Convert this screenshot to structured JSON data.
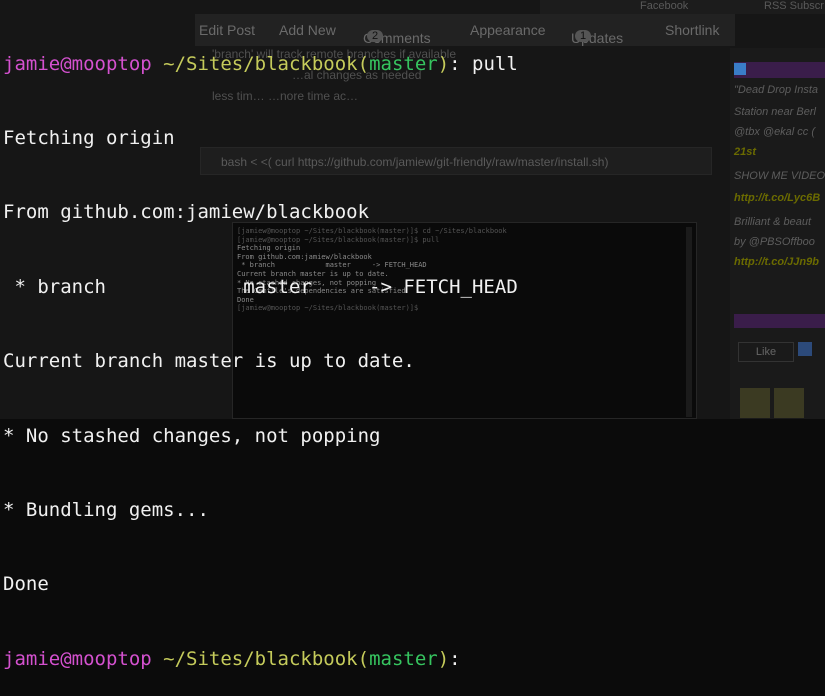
{
  "background_page": {
    "top_tabs": [
      "Facebook",
      "RSS Subscr"
    ],
    "nav_items": [
      {
        "label": "Edit Post"
      },
      {
        "label": "Add New"
      },
      {
        "label": "Comments",
        "badge": "2"
      },
      {
        "label": "Appearance"
      },
      {
        "label": "Updates",
        "badge": "1"
      },
      {
        "label": "Shortlink"
      }
    ],
    "list_lines": [
      "'branch' will track remote branches if available",
      "…al changes as needed",
      "less tim…        …nore time ac…"
    ],
    "code_line": "bash < <( curl https://github.com/jamiew/git-friendly/raw/master/install.sh)",
    "sidebar": {
      "tweets": [
        "\"Dead Drop Insta",
        "Station near Berl",
        "@tbx @ekal cc (",
        "21st",
        "SHOW ME VIDEO",
        "http://t.co/Lyc6B",
        "Brilliant & beaut",
        "by @PBSOffboo",
        "http://t.co/JJn9b"
      ],
      "like_label": "Like"
    }
  },
  "inner_terminal": {
    "lines": [
      "[jamiew@mooptop ~/Sites/blackbook(master)]$ cd ~/Sites/blackbook",
      "[jamiew@mooptop ~/Sites/blackbook(master)]$ pull",
      "Fetching origin",
      "From github.com:jamiew/blackbook",
      " * branch            master     -> FETCH_HEAD",
      "Current branch master is up to date.",
      "* No stashed changes, not popping",
      "The Gemfile's dependencies are satisfied",
      "Done",
      "[jamiew@mooptop ~/Sites/blackbook(master)]$"
    ]
  },
  "terminal": {
    "prompt1": {
      "user": "jamie@mooptop",
      "path": " ~/Sites/blackbook",
      "open": "(",
      "branch": "master",
      "close": ")",
      "cmd": ": pull"
    },
    "output": [
      "Fetching origin",
      "From github.com:jamiew/blackbook",
      " * branch            master     -> FETCH_HEAD",
      "Current branch master is up to date.",
      "* No stashed changes, not popping",
      "* Bundling gems...",
      "Done"
    ],
    "prompt2": {
      "user": "jamie@mooptop",
      "path": " ~/Sites/blackbook",
      "open": "(",
      "branch": "master",
      "close": ")",
      "cmd": ":"
    }
  },
  "colors": {
    "background": "#0b0b0b",
    "text": "#f1f1f1",
    "prompt_user": "#d451cf",
    "prompt_path": "#c5cb5b",
    "prompt_branch": "#36c45f"
  }
}
